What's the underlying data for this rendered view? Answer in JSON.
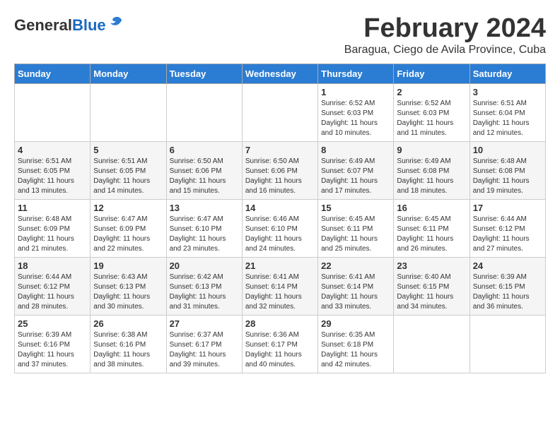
{
  "logo": {
    "general": "General",
    "blue": "Blue"
  },
  "title": "February 2024",
  "subtitle": "Baragua, Ciego de Avila Province, Cuba",
  "days_header": [
    "Sunday",
    "Monday",
    "Tuesday",
    "Wednesday",
    "Thursday",
    "Friday",
    "Saturday"
  ],
  "weeks": [
    [
      {
        "day": "",
        "info": ""
      },
      {
        "day": "",
        "info": ""
      },
      {
        "day": "",
        "info": ""
      },
      {
        "day": "",
        "info": ""
      },
      {
        "day": "1",
        "info": "Sunrise: 6:52 AM\nSunset: 6:03 PM\nDaylight: 11 hours\nand 10 minutes."
      },
      {
        "day": "2",
        "info": "Sunrise: 6:52 AM\nSunset: 6:03 PM\nDaylight: 11 hours\nand 11 minutes."
      },
      {
        "day": "3",
        "info": "Sunrise: 6:51 AM\nSunset: 6:04 PM\nDaylight: 11 hours\nand 12 minutes."
      }
    ],
    [
      {
        "day": "4",
        "info": "Sunrise: 6:51 AM\nSunset: 6:05 PM\nDaylight: 11 hours\nand 13 minutes."
      },
      {
        "day": "5",
        "info": "Sunrise: 6:51 AM\nSunset: 6:05 PM\nDaylight: 11 hours\nand 14 minutes."
      },
      {
        "day": "6",
        "info": "Sunrise: 6:50 AM\nSunset: 6:06 PM\nDaylight: 11 hours\nand 15 minutes."
      },
      {
        "day": "7",
        "info": "Sunrise: 6:50 AM\nSunset: 6:06 PM\nDaylight: 11 hours\nand 16 minutes."
      },
      {
        "day": "8",
        "info": "Sunrise: 6:49 AM\nSunset: 6:07 PM\nDaylight: 11 hours\nand 17 minutes."
      },
      {
        "day": "9",
        "info": "Sunrise: 6:49 AM\nSunset: 6:08 PM\nDaylight: 11 hours\nand 18 minutes."
      },
      {
        "day": "10",
        "info": "Sunrise: 6:48 AM\nSunset: 6:08 PM\nDaylight: 11 hours\nand 19 minutes."
      }
    ],
    [
      {
        "day": "11",
        "info": "Sunrise: 6:48 AM\nSunset: 6:09 PM\nDaylight: 11 hours\nand 21 minutes."
      },
      {
        "day": "12",
        "info": "Sunrise: 6:47 AM\nSunset: 6:09 PM\nDaylight: 11 hours\nand 22 minutes."
      },
      {
        "day": "13",
        "info": "Sunrise: 6:47 AM\nSunset: 6:10 PM\nDaylight: 11 hours\nand 23 minutes."
      },
      {
        "day": "14",
        "info": "Sunrise: 6:46 AM\nSunset: 6:10 PM\nDaylight: 11 hours\nand 24 minutes."
      },
      {
        "day": "15",
        "info": "Sunrise: 6:45 AM\nSunset: 6:11 PM\nDaylight: 11 hours\nand 25 minutes."
      },
      {
        "day": "16",
        "info": "Sunrise: 6:45 AM\nSunset: 6:11 PM\nDaylight: 11 hours\nand 26 minutes."
      },
      {
        "day": "17",
        "info": "Sunrise: 6:44 AM\nSunset: 6:12 PM\nDaylight: 11 hours\nand 27 minutes."
      }
    ],
    [
      {
        "day": "18",
        "info": "Sunrise: 6:44 AM\nSunset: 6:12 PM\nDaylight: 11 hours\nand 28 minutes."
      },
      {
        "day": "19",
        "info": "Sunrise: 6:43 AM\nSunset: 6:13 PM\nDaylight: 11 hours\nand 30 minutes."
      },
      {
        "day": "20",
        "info": "Sunrise: 6:42 AM\nSunset: 6:13 PM\nDaylight: 11 hours\nand 31 minutes."
      },
      {
        "day": "21",
        "info": "Sunrise: 6:41 AM\nSunset: 6:14 PM\nDaylight: 11 hours\nand 32 minutes."
      },
      {
        "day": "22",
        "info": "Sunrise: 6:41 AM\nSunset: 6:14 PM\nDaylight: 11 hours\nand 33 minutes."
      },
      {
        "day": "23",
        "info": "Sunrise: 6:40 AM\nSunset: 6:15 PM\nDaylight: 11 hours\nand 34 minutes."
      },
      {
        "day": "24",
        "info": "Sunrise: 6:39 AM\nSunset: 6:15 PM\nDaylight: 11 hours\nand 36 minutes."
      }
    ],
    [
      {
        "day": "25",
        "info": "Sunrise: 6:39 AM\nSunset: 6:16 PM\nDaylight: 11 hours\nand 37 minutes."
      },
      {
        "day": "26",
        "info": "Sunrise: 6:38 AM\nSunset: 6:16 PM\nDaylight: 11 hours\nand 38 minutes."
      },
      {
        "day": "27",
        "info": "Sunrise: 6:37 AM\nSunset: 6:17 PM\nDaylight: 11 hours\nand 39 minutes."
      },
      {
        "day": "28",
        "info": "Sunrise: 6:36 AM\nSunset: 6:17 PM\nDaylight: 11 hours\nand 40 minutes."
      },
      {
        "day": "29",
        "info": "Sunrise: 6:35 AM\nSunset: 6:18 PM\nDaylight: 11 hours\nand 42 minutes."
      },
      {
        "day": "",
        "info": ""
      },
      {
        "day": "",
        "info": ""
      }
    ]
  ]
}
